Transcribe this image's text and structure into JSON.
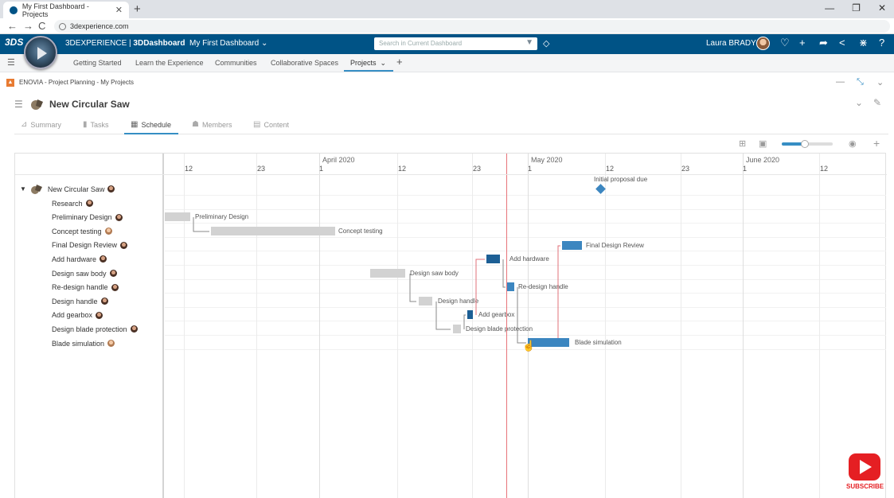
{
  "browser": {
    "tab_title": "My First Dashboard - Projects",
    "url": "3dexperience.com",
    "new_tab": "+",
    "close_tab": "✕",
    "controls": [
      "—",
      "❐",
      "✕"
    ],
    "nav": [
      "←",
      "→",
      "C"
    ]
  },
  "topbar": {
    "logo": "3DS",
    "brand_prefix": "3DEXPERIENCE | ",
    "brand_app": "3DDashboard",
    "dashboard_name": "My First Dashboard",
    "search_placeholder": "Search in Current Dashboard",
    "user_name": "Laura BRADY",
    "accent_color": "#005386",
    "icons": [
      "tag-icon",
      "notification-icon",
      "plus-icon",
      "share-icon",
      "network-icon",
      "apps-icon",
      "help-icon"
    ]
  },
  "dashboard_tabs": {
    "items": [
      "Getting Started",
      "Learn the Experience",
      "Communities",
      "Collaborative Spaces",
      "Projects"
    ],
    "active": "Projects",
    "add": "+"
  },
  "widget": {
    "title": "ENOVIA - Project Planning - My Projects"
  },
  "project": {
    "title": "New Circular Saw",
    "tabs": [
      "Summary",
      "Tasks",
      "Schedule",
      "Members",
      "Content"
    ],
    "active_tab": "Schedule"
  },
  "toolbar": {
    "zoom_level": 0.45
  },
  "gantt": {
    "months": [
      "April 2020",
      "May 2020",
      "June 2020"
    ],
    "day_ticks": [
      "12",
      "23",
      "1",
      "12",
      "23",
      "1",
      "12",
      "23",
      "1",
      "12"
    ],
    "root_task": "New Circular Saw",
    "tasks": [
      {
        "name": "Research",
        "avatar": "m"
      },
      {
        "name": "Preliminary Design",
        "avatar": "m"
      },
      {
        "name": "Concept testing",
        "avatar": "f"
      },
      {
        "name": "Final Design Review",
        "avatar": "m"
      },
      {
        "name": "Add hardware",
        "avatar": "m"
      },
      {
        "name": "Design saw body",
        "avatar": "m"
      },
      {
        "name": "Re-design handle",
        "avatar": "m"
      },
      {
        "name": "Design handle",
        "avatar": "m"
      },
      {
        "name": "Add gearbox",
        "avatar": "m"
      },
      {
        "name": "Design blade protection",
        "avatar": "m"
      },
      {
        "name": "Blade simulation",
        "avatar": "f"
      }
    ],
    "bar_labels": {
      "milestone": "Initial proposal due",
      "preliminary": "Preliminary Design",
      "concept": "Concept testing",
      "final_review": "Final Design Review",
      "add_hardware": "Add hardware",
      "saw_body": "Design saw body",
      "redesign": "Re-design handle",
      "design_handle": "Design handle",
      "gearbox": "Add gearbox",
      "blade_protection": "Design blade protection",
      "blade_sim": "Blade simulation"
    }
  },
  "subscribe": "SUBSCRIBE"
}
